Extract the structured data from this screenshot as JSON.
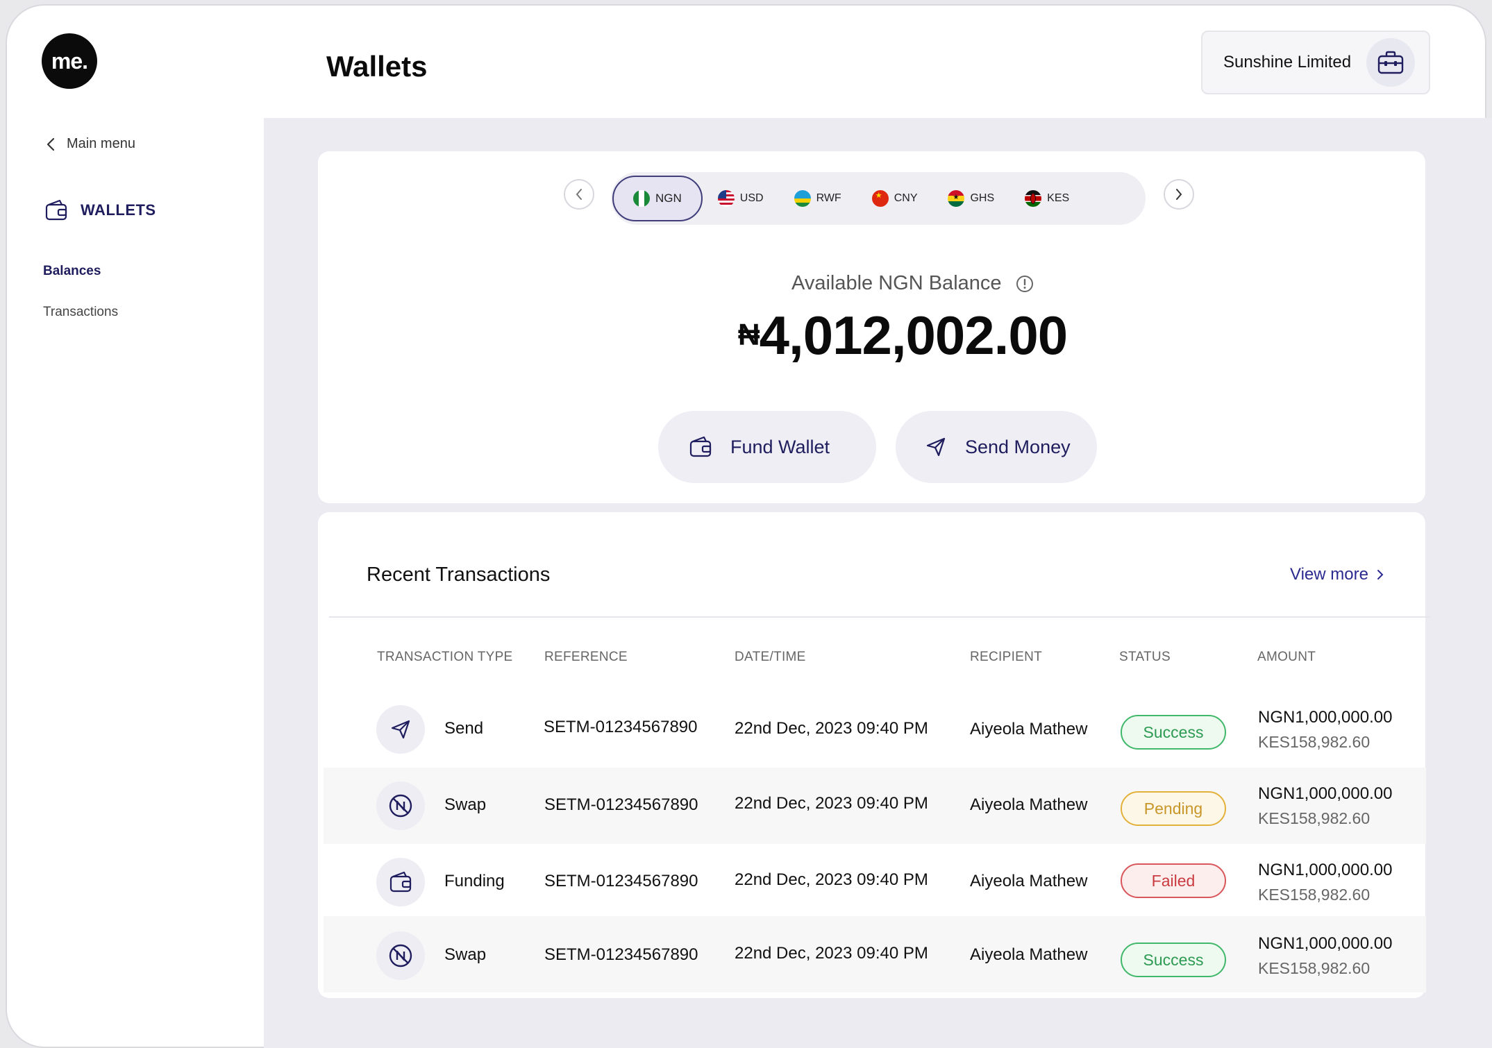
{
  "sidebar": {
    "logo_text": "me.",
    "main_menu": "Main menu",
    "section_title": "WALLETS",
    "items": [
      {
        "label": "Balances"
      },
      {
        "label": "Transactions"
      }
    ]
  },
  "header": {
    "title": "Wallets",
    "account_name": "Sunshine Limited"
  },
  "currencies": [
    {
      "code": "NGN",
      "active": true
    },
    {
      "code": "USD",
      "active": false
    },
    {
      "code": "RWF",
      "active": false
    },
    {
      "code": "CNY",
      "active": false
    },
    {
      "code": "GHS",
      "active": false
    },
    {
      "code": "KES",
      "active": false
    }
  ],
  "balance": {
    "label": "Available NGN Balance",
    "symbol": "₦",
    "amount": "4,012,002.00",
    "fund_label": "Fund Wallet",
    "send_label": "Send Money"
  },
  "transactions": {
    "title": "Recent Transactions",
    "view_more": "View more",
    "columns": [
      "TRANSACTION TYPE",
      "REFERENCE",
      "DATE/TIME",
      "RECIPIENT",
      "STATUS",
      "AMOUNT"
    ],
    "rows": [
      {
        "type": "Send",
        "icon": "send-icon",
        "reference": "SETM-01234567890",
        "datetime": "22nd Dec, 2023 09:40 PM",
        "recipient": "Aiyeola Mathew",
        "status": "Success",
        "amount": "NGN1,000,000.00",
        "amount_alt": "KES158,982.60"
      },
      {
        "type": "Swap",
        "icon": "swap-icon",
        "reference": "SETM-01234567890",
        "datetime": "22nd Dec, 2023 09:40 PM",
        "recipient": "Aiyeola Mathew",
        "status": "Pending",
        "amount": "NGN1,000,000.00",
        "amount_alt": "KES158,982.60"
      },
      {
        "type": "Funding",
        "icon": "wallet-icon",
        "reference": "SETM-01234567890",
        "datetime": "22nd Dec, 2023 09:40 PM",
        "recipient": "Aiyeola Mathew",
        "status": "Failed",
        "amount": "NGN1,000,000.00",
        "amount_alt": "KES158,982.60"
      },
      {
        "type": "Swap",
        "icon": "swap-icon",
        "reference": "SETM-01234567890",
        "datetime": "22nd Dec, 2023 09:40 PM",
        "recipient": "Aiyeola Mathew",
        "status": "Success",
        "amount": "NGN1,000,000.00",
        "amount_alt": "KES158,982.60"
      }
    ]
  },
  "colors": {
    "brand": "#1f1d5e",
    "success": "#2c9a52",
    "pending": "#c9962a",
    "failed": "#c93b40"
  }
}
